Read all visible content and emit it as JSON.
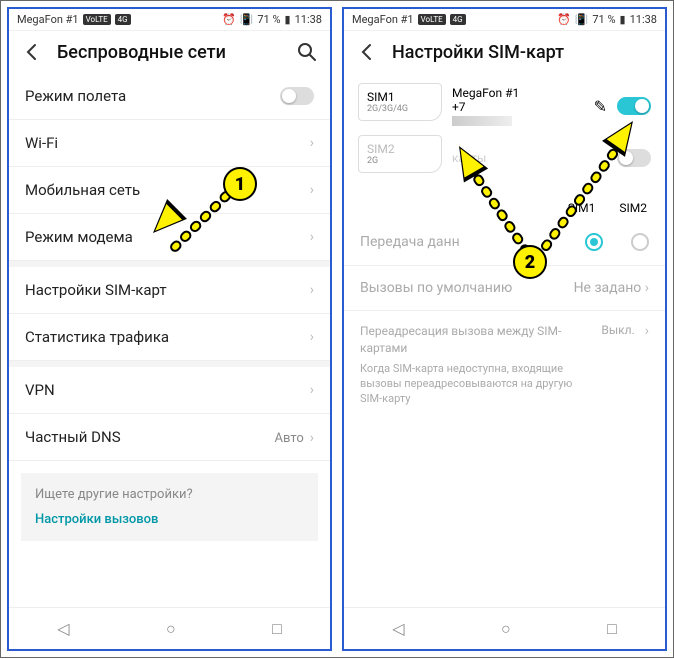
{
  "status": {
    "carrier": "MegaFon #1",
    "badge1": "VoLTE",
    "badge2": "4G",
    "alarm_icon": "alarm",
    "vibrate_icon": "vibrate",
    "battery_pct": "71 %",
    "time": "11:38"
  },
  "left": {
    "title": "Беспроводные сети",
    "rows": {
      "airplane": "Режим полета",
      "wifi": "Wi-Fi",
      "mobile": "Мобильная сеть",
      "modem": "Режим модема",
      "simsettings": "Настройки SIM-карт",
      "traffic": "Статистика трафика",
      "vpn": "VPN",
      "dns": "Частный DNS",
      "dns_val": "Авто"
    },
    "tip_q": "Ищете другие настройки?",
    "tip_link": "Настройки вызовов"
  },
  "right": {
    "title": "Настройки SIM-карт",
    "sim1": {
      "label": "SIM1",
      "modes": "2G/3G/4G",
      "name": "MegaFon #1",
      "num_prefix": "+7"
    },
    "sim2": {
      "label": "SIM2",
      "modes": "2G",
      "hint": "карты"
    },
    "col1": "SIM1",
    "col2": "SIM2",
    "data_label": "Передача данн",
    "calls_label": "Вызовы по умолчанию",
    "calls_val": "Не задано",
    "fwd_title": "Переадресация вызова между SIM-картами",
    "fwd_desc": "Когда SIM-карта недоступна, входящие вызовы переадресовываются на другую SIM-карту",
    "fwd_state": "Выкл."
  },
  "annotations": {
    "b1": "1",
    "b2": "2"
  }
}
